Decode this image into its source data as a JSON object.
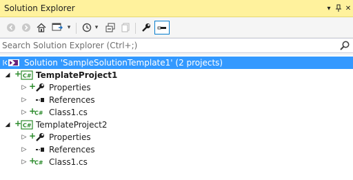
{
  "window": {
    "title": "Solution Explorer",
    "pin_icon": "pin-icon",
    "close_icon": "close-icon"
  },
  "toolbar": {
    "buttons": [
      "back-icon",
      "forward-icon",
      "home-icon",
      "sync-icon",
      "history-icon",
      "collapse-all-icon",
      "show-all-files-icon",
      "properties-icon",
      "preview-icon"
    ]
  },
  "search": {
    "placeholder": "Search Solution Explorer (Ctrl+;)",
    "value": ""
  },
  "tree": {
    "solution": {
      "label": "Solution 'SampleSolutionTemplate1' (2 projects)"
    },
    "projects": [
      {
        "name": "TemplateProject1",
        "items": [
          {
            "label": "Properties"
          },
          {
            "label": "References"
          },
          {
            "label": "Class1.cs"
          }
        ]
      },
      {
        "name": "TemplateProject2",
        "items": [
          {
            "label": "Properties"
          },
          {
            "label": "References"
          },
          {
            "label": "Class1.cs"
          }
        ]
      }
    ]
  },
  "colors": {
    "title_bg": "#fff29d",
    "selection": "#3399ff",
    "csharp_green": "#2a8a2a"
  }
}
